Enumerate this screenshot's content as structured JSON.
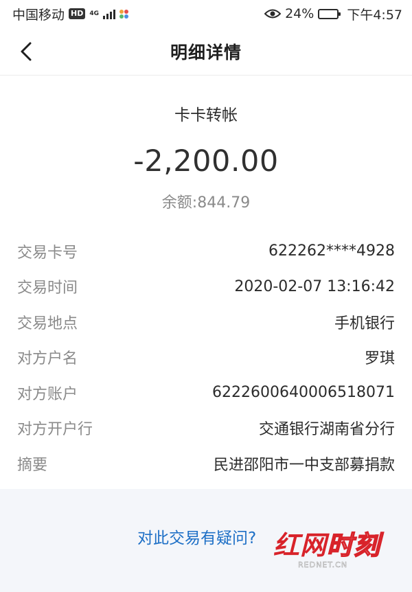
{
  "status_bar": {
    "carrier": "中国移动",
    "hd": "HD",
    "network": "4G",
    "battery_percent": "24%",
    "battery_level": 0.24,
    "time": "下午4:57"
  },
  "nav": {
    "title": "明细详情"
  },
  "summary": {
    "type": "卡卡转帐",
    "amount": "-2,200.00",
    "balance": "余额:844.79"
  },
  "details": [
    {
      "label": "交易卡号",
      "value": "622262****4928"
    },
    {
      "label": "交易时间",
      "value": "2020-02-07 13:16:42"
    },
    {
      "label": "交易地点",
      "value": "手机银行"
    },
    {
      "label": "对方户名",
      "value": "罗琪"
    },
    {
      "label": "对方账户",
      "value": "6222600640006518071"
    },
    {
      "label": "对方开户行",
      "value": "交通银行湖南省分行"
    },
    {
      "label": "摘要",
      "value": "民进邵阳市一中支部募捐款"
    }
  ],
  "footer": {
    "question_link": "对此交易有疑问?"
  },
  "watermark": {
    "logo_part1": "红网",
    "logo_part2": "时刻",
    "site": "REDNET.CN"
  },
  "colors": {
    "link": "#1d6fc6",
    "footer_bg": "#f4f6fa",
    "watermark_red": "#d8232a"
  }
}
